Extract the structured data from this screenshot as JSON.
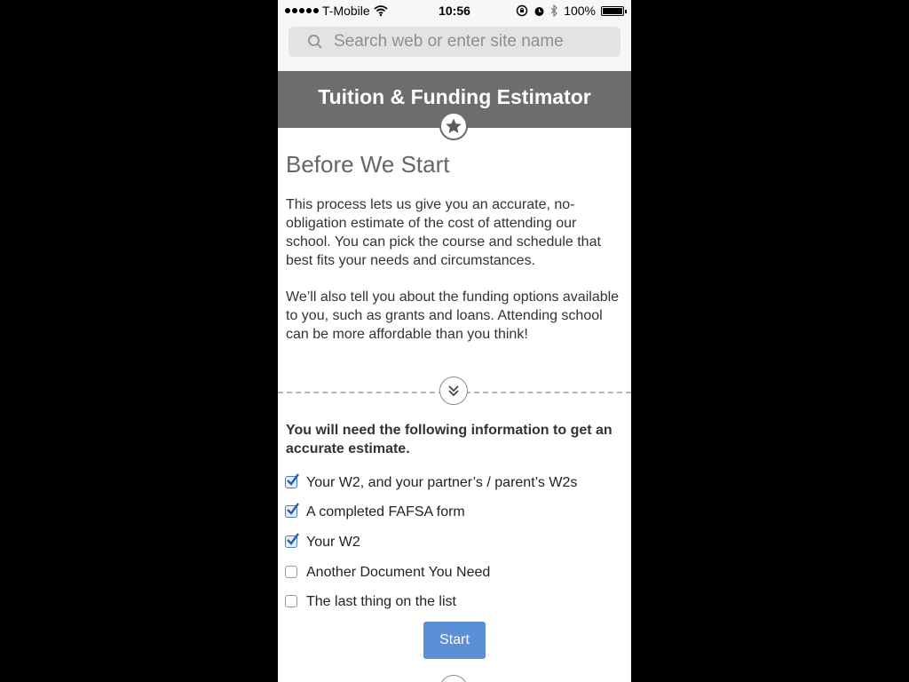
{
  "status_bar": {
    "carrier": "T-Mobile",
    "time": "10:56",
    "battery": "100%",
    "battery_level": 1.0,
    "icons": [
      "signal-dots-icon",
      "wifi-icon",
      "rotation-lock-icon",
      "alarm-icon",
      "bluetooth-icon",
      "battery-icon"
    ]
  },
  "browser": {
    "search_placeholder": "Search web or enter site name",
    "search_value": ""
  },
  "header": {
    "title": "Tuition & Funding Estimator",
    "badge_icon": "star-icon"
  },
  "intro": {
    "title": "Before We Start",
    "paragraph1": "This process lets us give you an accurate, no-obligation estimate of the cost of attending our school. You can pick the course and schedule that best fits your needs and circumstances.",
    "paragraph2": "We’ll also tell you about the funding options available to you, such as grants and loans. Attending school can be more affordable than you think!"
  },
  "divider_icon": "double-chevron-down-icon",
  "requirements": {
    "heading": "You will need the following information to get an accurate estimate.",
    "items": [
      {
        "label": "Your W2, and your partner’s / parent’s W2s",
        "checked": true
      },
      {
        "label": "A completed FAFSA form",
        "checked": true
      },
      {
        "label": "Your W2",
        "checked": true
      },
      {
        "label": "Another Document You Need",
        "checked": false
      },
      {
        "label": "The last thing on the list",
        "checked": false
      }
    ]
  },
  "actions": {
    "start_label": "Start"
  },
  "colors": {
    "header_bg": "#6d6d6d",
    "button_bg": "#5b8fd6",
    "check_color": "#2a5db0"
  }
}
